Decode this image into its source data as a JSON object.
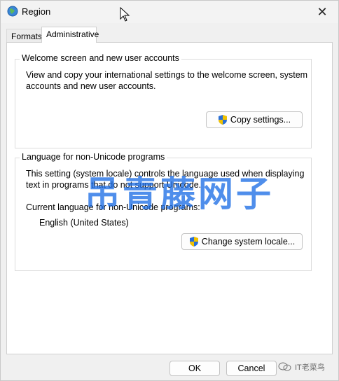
{
  "window": {
    "title": "Region",
    "close_glyph": "✕"
  },
  "tabs": [
    {
      "label": "Formats",
      "active": false
    },
    {
      "label": "Administrative",
      "active": true
    }
  ],
  "welcome_group": {
    "title": "Welcome screen and new user accounts",
    "description_line1": "View and copy your international settings to the welcome screen, system",
    "description_line2": "accounts and new user accounts.",
    "button_label": "Copy settings..."
  },
  "locale_group": {
    "title": "Language for non-Unicode programs",
    "description_line1": "This setting (system locale) controls the language used when displaying",
    "description_line2": "text in programs that do not support Unicode.",
    "current_label": "Current language for non-Unicode programs:",
    "current_value": "English (United States)",
    "button_label": "Change system locale..."
  },
  "watermark": {
    "text": "吊青藤网子"
  },
  "footer": {
    "ok_label": "OK",
    "cancel_label": "Cancel",
    "watermark_text": "IT老菜鸟"
  },
  "colors": {
    "accent": "#005fb8",
    "watermark": "#1e6ee6"
  }
}
